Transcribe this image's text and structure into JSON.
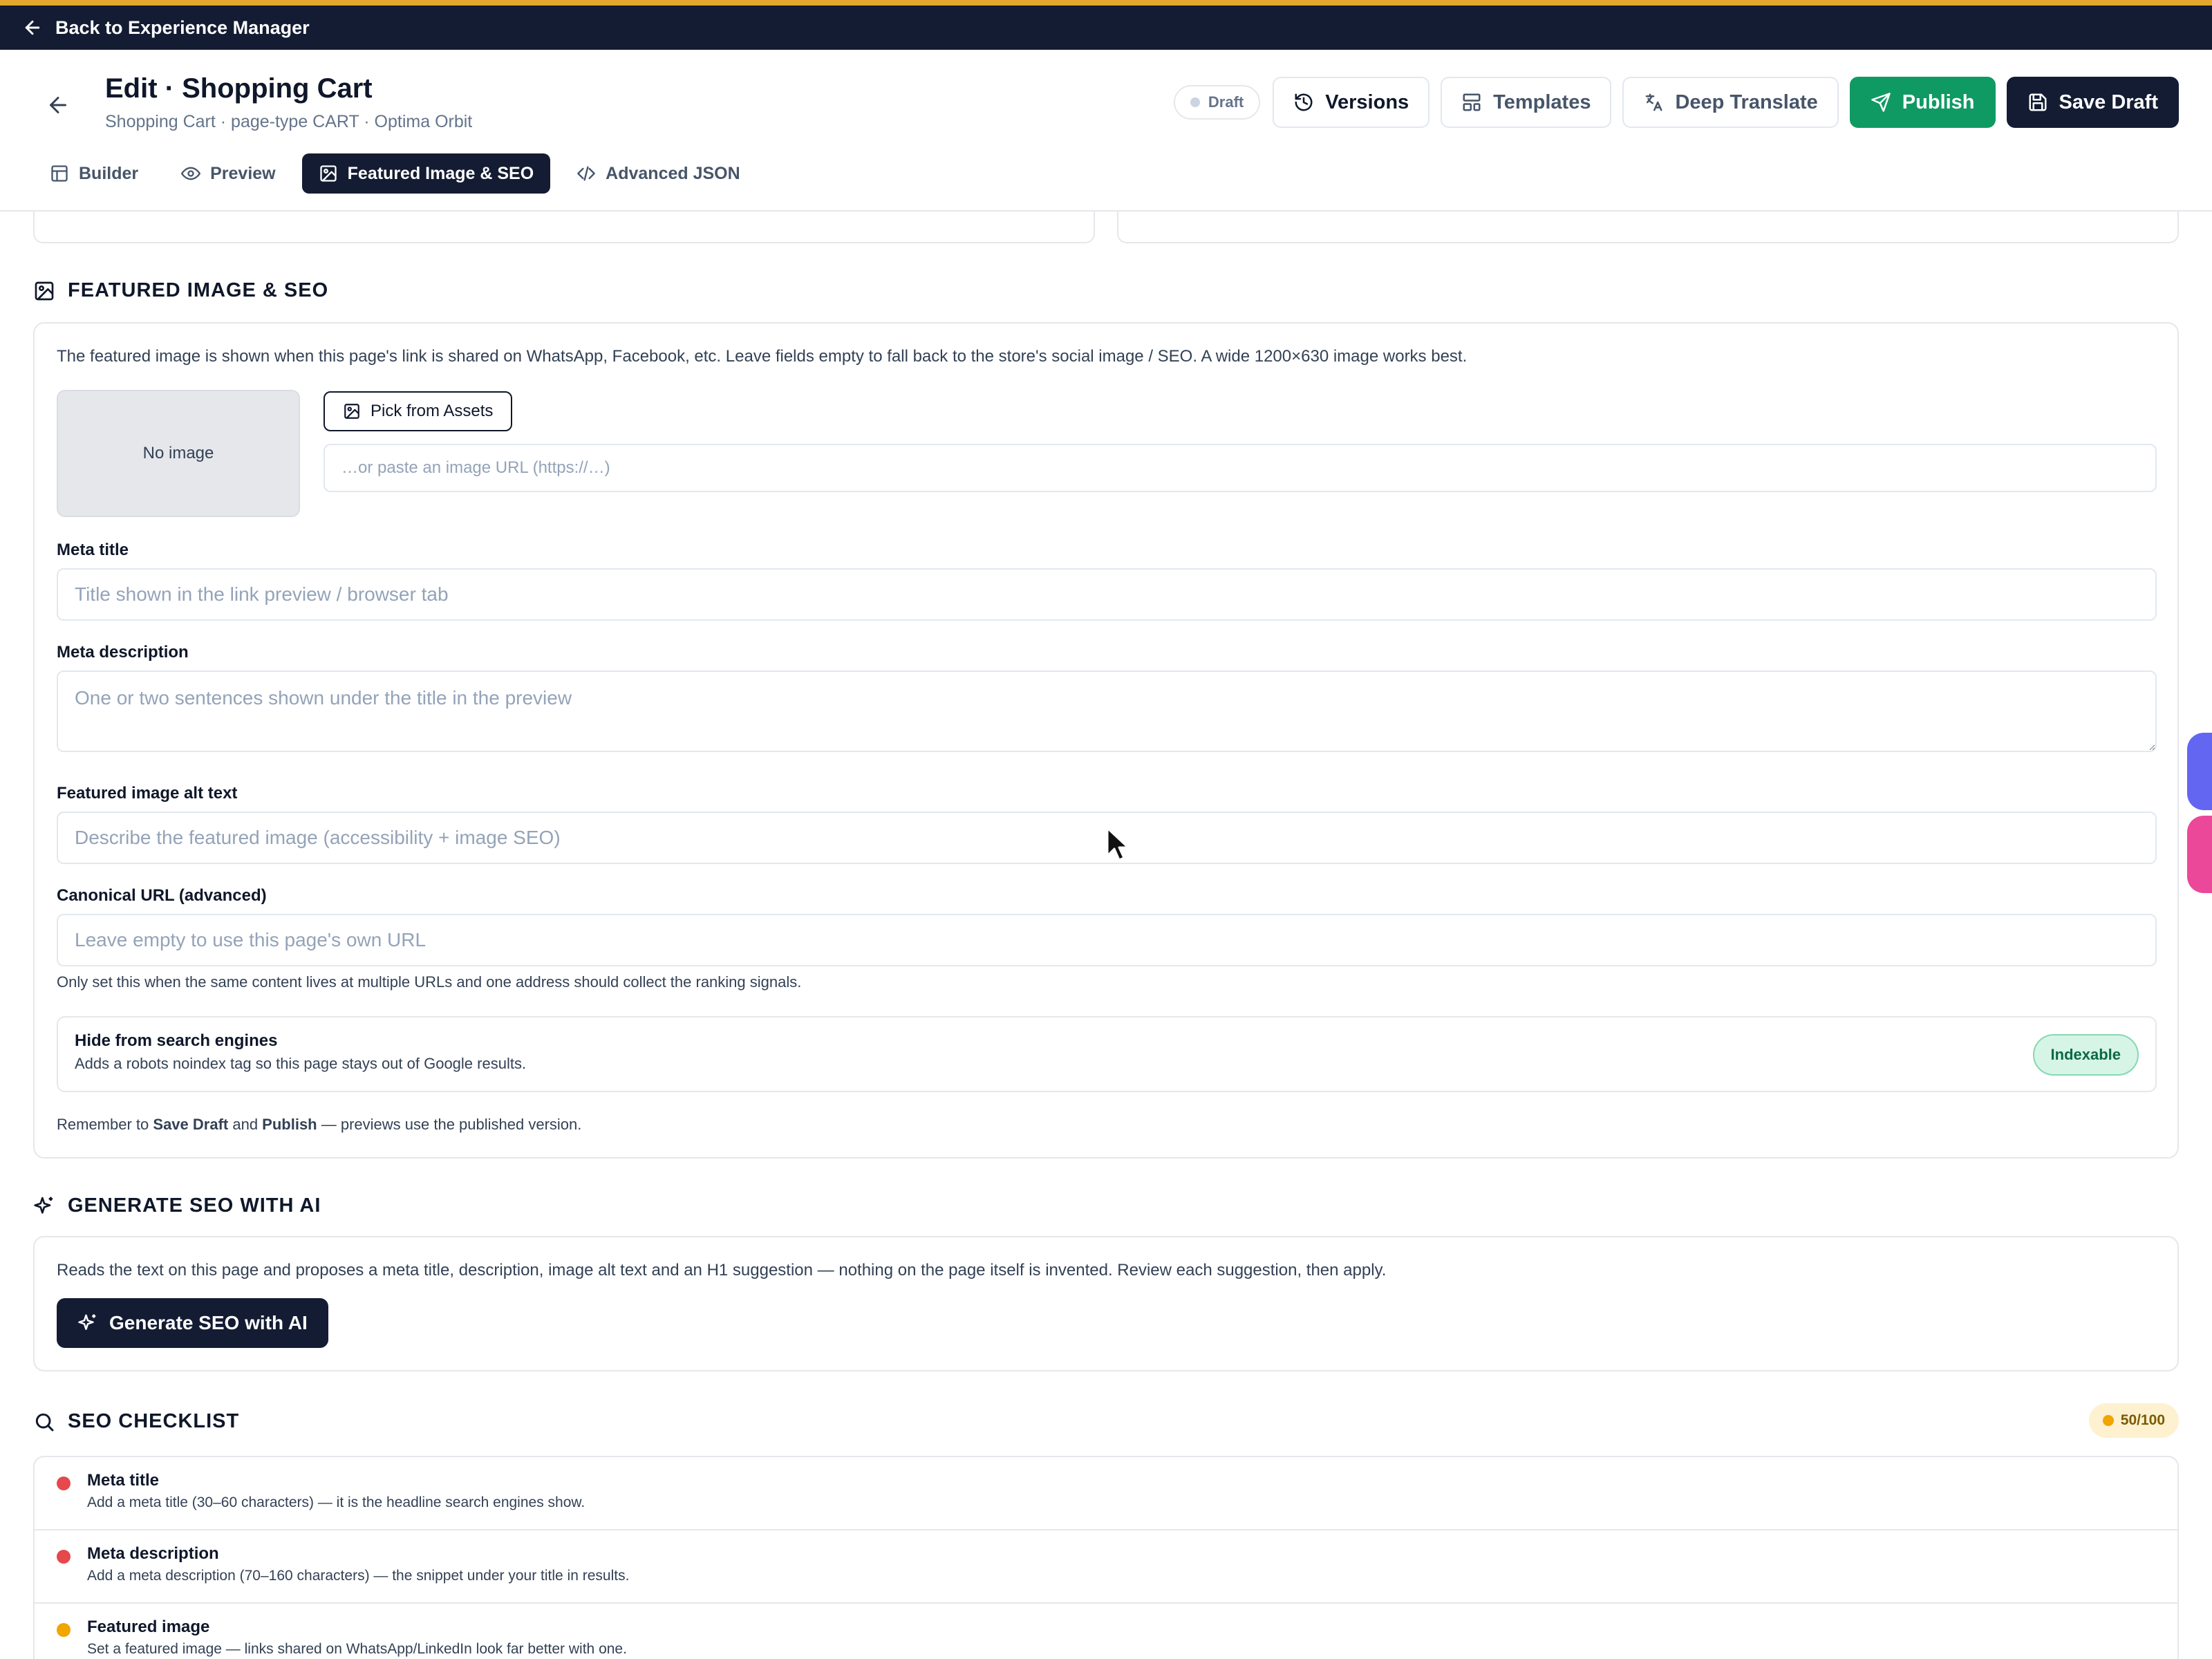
{
  "topbar": {
    "back_label": "Back to Experience Manager"
  },
  "header": {
    "title": "Edit · Shopping Cart",
    "subtitle": "Shopping Cart · page-type CART · Optima Orbit",
    "status": "Draft",
    "buttons": {
      "versions": "Versions",
      "templates": "Templates",
      "deep_translate": "Deep Translate",
      "publish": "Publish",
      "save_draft": "Save Draft"
    }
  },
  "tabs": [
    {
      "label": "Builder",
      "icon": "layout-icon"
    },
    {
      "label": "Preview",
      "icon": "eye-icon"
    },
    {
      "label": "Featured Image & SEO",
      "icon": "image-icon",
      "active": true
    },
    {
      "label": "Advanced JSON",
      "icon": "code-icon"
    }
  ],
  "featured": {
    "heading": "FEATURED IMAGE & SEO",
    "intro": "The featured image is shown when this page's link is shared on WhatsApp, Facebook, etc. Leave fields empty to fall back to the store's social image / SEO. A wide 1200×630 image works best.",
    "no_image": "No image",
    "pick_assets": "Pick from Assets",
    "image_url": {
      "value": "",
      "placeholder": "…or paste an image URL (https://…)"
    },
    "meta_title": {
      "label": "Meta title",
      "value": "",
      "placeholder": "Title shown in the link preview / browser tab"
    },
    "meta_description": {
      "label": "Meta description",
      "value": "",
      "placeholder": "One or two sentences shown under the title in the preview"
    },
    "alt_text": {
      "label": "Featured image alt text",
      "value": "",
      "placeholder": "Describe the featured image (accessibility + image SEO)"
    },
    "canonical": {
      "label": "Canonical URL (advanced)",
      "value": "",
      "placeholder": "Leave empty to use this page's own URL",
      "help": "Only set this when the same content lives at multiple URLs and one address should collect the ranking signals."
    },
    "noindex": {
      "title": "Hide from search engines",
      "description": "Adds a robots noindex tag so this page stays out of Google results.",
      "state": "Indexable"
    },
    "reminder": {
      "prefix": "Remember to ",
      "save": "Save Draft",
      "and": " and ",
      "publish": "Publish",
      "suffix": " — previews use the published version."
    }
  },
  "ai": {
    "heading": "GENERATE SEO WITH AI",
    "intro": "Reads the text on this page and proposes a meta title, description, image alt text and an H1 suggestion — nothing on the page itself is invented. Review each suggestion, then apply.",
    "button": "Generate SEO with AI"
  },
  "checklist": {
    "heading": "SEO CHECKLIST",
    "score": "50/100",
    "items": [
      {
        "title": "Meta title",
        "description": "Add a meta title (30–60 characters) — it is the headline search engines show.",
        "status_color": "#e5484d"
      },
      {
        "title": "Meta description",
        "description": "Add a meta description (70–160 characters) — the snippet under your title in results.",
        "status_color": "#e5484d"
      },
      {
        "title": "Featured image",
        "description": "Set a featured image — links shared on WhatsApp/LinkedIn look far better with one.",
        "status_color": "#f0a500"
      }
    ]
  },
  "colors": {
    "accent": "#141c33",
    "topbar_stripe": "#e3a72f",
    "publish_green": "#0f9a64"
  }
}
